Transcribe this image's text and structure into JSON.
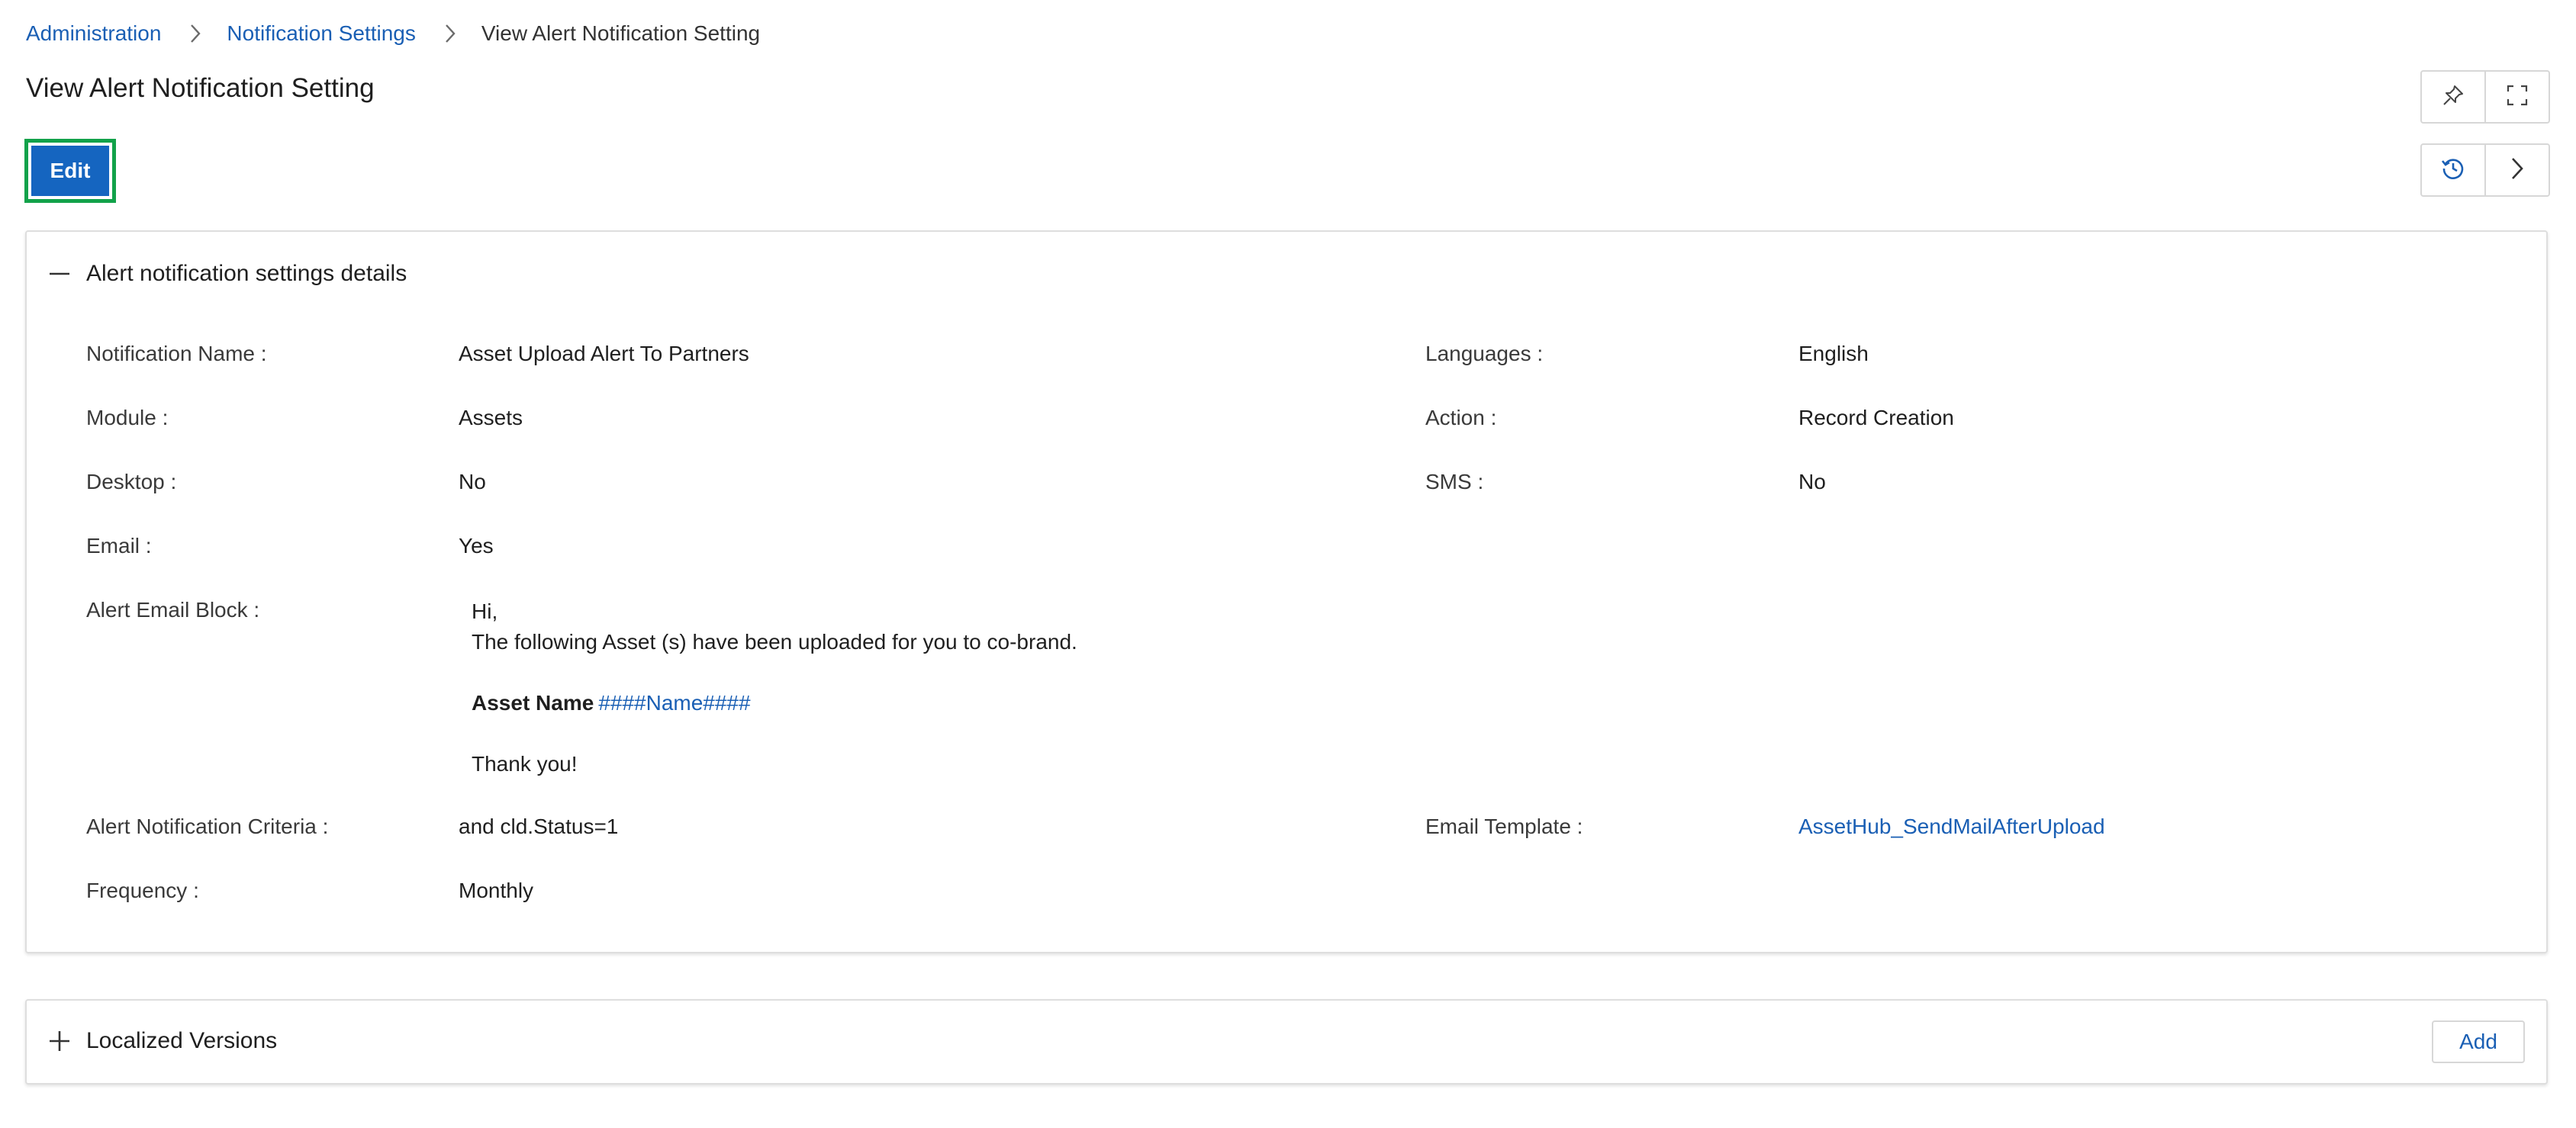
{
  "breadcrumb": {
    "items": [
      "Administration",
      "Notification Settings"
    ],
    "current": "View Alert Notification Setting"
  },
  "page": {
    "title": "View Alert Notification Setting"
  },
  "toolbar": {
    "edit_label": "Edit",
    "icons": [
      "pin-icon",
      "fullscreen-icon",
      "history-icon",
      "chevron-right-icon"
    ]
  },
  "details": {
    "header": "Alert notification settings details",
    "fields": {
      "notification_name": {
        "label": "Notification Name :",
        "value": "Asset Upload Alert To Partners"
      },
      "languages": {
        "label": "Languages :",
        "value": "English"
      },
      "module": {
        "label": "Module :",
        "value": "Assets"
      },
      "action": {
        "label": "Action :",
        "value": "Record Creation"
      },
      "desktop": {
        "label": "Desktop :",
        "value": "No"
      },
      "sms": {
        "label": "SMS :",
        "value": "No"
      },
      "email": {
        "label": "Email :",
        "value": "Yes"
      },
      "alert_email_block": {
        "label": "Alert Email Block :"
      },
      "criteria": {
        "label": "Alert Notification Criteria :",
        "value": "and cld.Status=1"
      },
      "email_template": {
        "label": "Email Template :",
        "value": "AssetHub_SendMailAfterUpload"
      },
      "frequency": {
        "label": "Frequency :",
        "value": "Monthly"
      }
    },
    "email_block": {
      "greeting": "Hi,",
      "body": "The following Asset (s) have been uploaded for you to co-brand.",
      "asset_label": "Asset Name",
      "asset_token": "####Name####",
      "closing": "Thank you!"
    }
  },
  "localized": {
    "header": "Localized Versions",
    "add_label": "Add"
  },
  "colors": {
    "accent": "#1565c0",
    "link": "#1a5fb4",
    "focus_border": "#12a24a"
  }
}
